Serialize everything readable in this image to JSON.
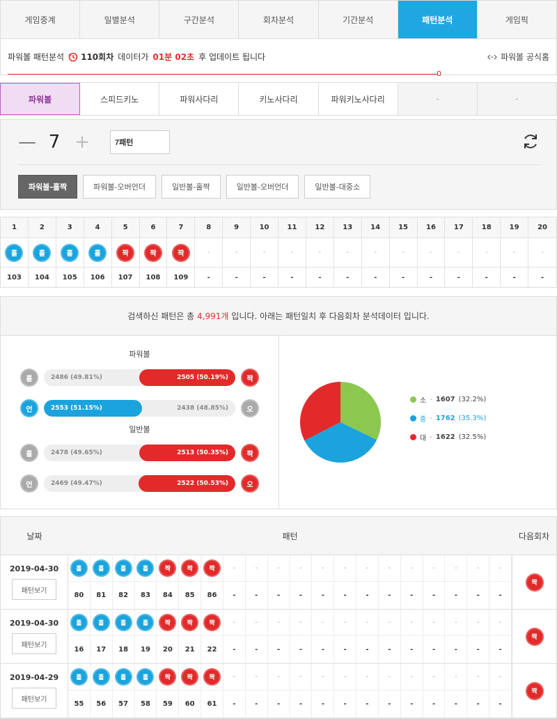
{
  "nav": {
    "tabs": [
      "게임중계",
      "일별분석",
      "구간분석",
      "회차분석",
      "기간분석",
      "패턴분석",
      "게임픽"
    ],
    "active_index": 5
  },
  "info": {
    "label": "파워볼 패턴분석",
    "round": "110회차",
    "data_text": "데이터가",
    "time": "01분 02초",
    "suffix": "후 업데이트 됩니다",
    "official_link": "파워볼 공식홈"
  },
  "game_tabs": {
    "items": [
      "파워볼",
      "스피드키노",
      "파워사다리",
      "키노사다리",
      "파워키노사다리",
      "-",
      "-"
    ],
    "active_index": 0
  },
  "panel": {
    "minus": "—",
    "count": "7",
    "plus": "+",
    "pattern_value": "7패턴",
    "filters": [
      "파워볼-홀짝",
      "파워볼-오버언더",
      "일반볼-홀짝",
      "일반볼-오버언더",
      "일반볼-대중소"
    ],
    "active_filter": 0
  },
  "pattern_grid": {
    "headers": [
      "1",
      "2",
      "3",
      "4",
      "5",
      "6",
      "7",
      "8",
      "9",
      "10",
      "11",
      "12",
      "13",
      "14",
      "15",
      "16",
      "17",
      "18",
      "19",
      "20"
    ],
    "balls": [
      "홀",
      "홀",
      "홀",
      "홀",
      "짝",
      "짝",
      "짝",
      "-",
      "-",
      "-",
      "-",
      "-",
      "-",
      "-",
      "-",
      "-",
      "-",
      "-",
      "-",
      "-"
    ],
    "rounds": [
      "103",
      "104",
      "105",
      "106",
      "107",
      "108",
      "109",
      "-",
      "-",
      "-",
      "-",
      "-",
      "-",
      "-",
      "-",
      "-",
      "-",
      "-",
      "-",
      "-"
    ]
  },
  "summary": {
    "prefix": "검색하신 패턴은 총",
    "count": "4,991개",
    "suffix": "입니다. 아래는 패턴일치 후 다음회차 분석데이터 입니다."
  },
  "stats": {
    "powerball_title": "파워볼",
    "normal_title": "일반볼",
    "rows": [
      {
        "left_ball": "홀",
        "left_text": "2486 (49.81%)",
        "left_pct": 49.81,
        "right_text": "2505 (50.19%)",
        "right_pct": 50.19,
        "right_ball": "짝",
        "win": "right"
      },
      {
        "left_ball": "언",
        "left_text": "2553 (51.15%)",
        "left_pct": 51.15,
        "right_text": "2438 (48.85%)",
        "right_pct": 48.85,
        "right_ball": "오",
        "win": "left"
      },
      {
        "left_ball": "홀",
        "left_text": "2478 (49.65%)",
        "left_pct": 49.65,
        "right_text": "2513 (50.35%)",
        "right_pct": 50.35,
        "right_ball": "짝",
        "win": "right"
      },
      {
        "left_ball": "언",
        "left_text": "2469 (49.47%)",
        "left_pct": 49.47,
        "right_text": "2522 (50.53%)",
        "right_pct": 50.53,
        "right_ball": "오",
        "win": "right"
      }
    ]
  },
  "chart_data": {
    "type": "pie",
    "categories": [
      "소",
      "중",
      "대"
    ],
    "values": [
      1607,
      1762,
      1622
    ],
    "percent_labels": [
      "(32.2%)",
      "(35.3%)",
      "(32.5%)"
    ],
    "colors": [
      "#8cc750",
      "#1aa3dc",
      "#e22a2a"
    ]
  },
  "history": {
    "headers": {
      "date": "날짜",
      "pattern": "패턴",
      "next": "다음회차"
    },
    "view_label": "패턴보기",
    "rows": [
      {
        "date": "2019-04-30",
        "balls": [
          "홀",
          "홀",
          "홀",
          "홀",
          "짝",
          "짝",
          "짝",
          "-",
          "-",
          "-",
          "-",
          "-",
          "-",
          "-",
          "-",
          "-",
          "-",
          "-",
          "-",
          "-"
        ],
        "rounds": [
          "80",
          "81",
          "82",
          "83",
          "84",
          "85",
          "86",
          "-",
          "-",
          "-",
          "-",
          "-",
          "-",
          "-",
          "-",
          "-",
          "-",
          "-",
          "-",
          "-"
        ],
        "next": "짝"
      },
      {
        "date": "2019-04-30",
        "balls": [
          "홀",
          "홀",
          "홀",
          "홀",
          "짝",
          "짝",
          "짝",
          "-",
          "-",
          "-",
          "-",
          "-",
          "-",
          "-",
          "-",
          "-",
          "-",
          "-",
          "-",
          "-"
        ],
        "rounds": [
          "16",
          "17",
          "18",
          "19",
          "20",
          "21",
          "22",
          "-",
          "-",
          "-",
          "-",
          "-",
          "-",
          "-",
          "-",
          "-",
          "-",
          "-",
          "-",
          "-"
        ],
        "next": "짝"
      },
      {
        "date": "2019-04-29",
        "balls": [
          "홀",
          "홀",
          "홀",
          "홀",
          "짝",
          "짝",
          "짝",
          "-",
          "-",
          "-",
          "-",
          "-",
          "-",
          "-",
          "-",
          "-",
          "-",
          "-",
          "-",
          "-"
        ],
        "rounds": [
          "55",
          "56",
          "57",
          "58",
          "59",
          "60",
          "61",
          "-",
          "-",
          "-",
          "-",
          "-",
          "-",
          "-",
          "-",
          "-",
          "-",
          "-",
          "-",
          "-"
        ],
        "next": "짝"
      }
    ]
  }
}
